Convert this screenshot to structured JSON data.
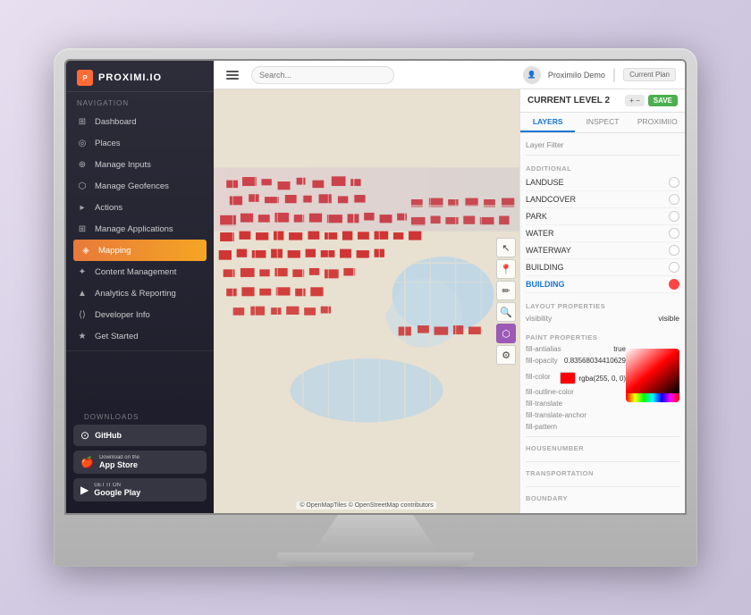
{
  "monitor": {
    "label": "Monitor display"
  },
  "app": {
    "logo": {
      "icon": "P",
      "text": "PROXIMI.IO"
    },
    "topbar": {
      "search_placeholder": "Search...",
      "user_name": "ProximiIo Demo",
      "plan_label": "Current Plan"
    },
    "sidebar": {
      "nav_label": "NAVIGATION",
      "downloads_label": "DOWNLOADS",
      "items": [
        {
          "id": "dashboard",
          "label": "Dashboard",
          "icon": "⊞"
        },
        {
          "id": "places",
          "label": "Places",
          "icon": "◎"
        },
        {
          "id": "manage-inputs",
          "label": "Manage Inputs",
          "icon": "⊕"
        },
        {
          "id": "manage-geofences",
          "label": "Manage Geofences",
          "icon": "⬡"
        },
        {
          "id": "actions",
          "label": "Actions",
          "icon": "▸"
        },
        {
          "id": "manage-applications",
          "label": "Manage Applications",
          "icon": "⊞"
        },
        {
          "id": "mapping",
          "label": "Mapping",
          "icon": "◈",
          "active": true
        },
        {
          "id": "content-management",
          "label": "Content Management",
          "icon": "✦"
        },
        {
          "id": "analytics",
          "label": "Analytics & Reporting",
          "icon": "▲"
        },
        {
          "id": "developer-info",
          "label": "Developer Info",
          "icon": "⟨⟩"
        },
        {
          "id": "get-started",
          "label": "Get Started",
          "icon": "★"
        }
      ],
      "downloads": [
        {
          "id": "github",
          "small": "",
          "large": "GitHub",
          "icon": "⊙"
        },
        {
          "id": "appstore",
          "small": "Download on the",
          "large": "App Store",
          "icon": "🍎"
        },
        {
          "id": "googleplay",
          "small": "GET IT ON",
          "large": "Google Play",
          "icon": "▶"
        }
      ]
    },
    "right_panel": {
      "title": "CURRENT LEVEL 2",
      "level_btn": "+  −",
      "save_btn": "SAVE",
      "tabs": [
        {
          "id": "layers",
          "label": "LAYERS",
          "active": true
        },
        {
          "id": "inspect",
          "label": "INSPECT"
        },
        {
          "id": "proximio",
          "label": "PROXIMIIO"
        }
      ],
      "layer_filter_label": "Layer Filter",
      "section_label": "ADDITIONAL",
      "layers": [
        {
          "name": "LANDUSE",
          "active": false
        },
        {
          "name": "LANDCOVER",
          "active": false
        },
        {
          "name": "PARK",
          "active": false
        },
        {
          "name": "WATER",
          "active": false
        },
        {
          "name": "WATERWAY",
          "active": false
        },
        {
          "name": "BUILDING",
          "active": false
        },
        {
          "name": "BUILDING",
          "active": true
        }
      ],
      "layout_section": "LAYOUT PROPERTIES",
      "layout_rows": [
        {
          "key": "visibility",
          "val": "visible"
        }
      ],
      "paint_section": "PAINT PROPERTIES",
      "paint_rows": [
        {
          "key": "fill-antialias",
          "val": "true"
        },
        {
          "key": "fill-opacity",
          "val": "0.83568034410629"
        },
        {
          "key": "fill-color",
          "val": "rgba(255, 0, 0)"
        },
        {
          "key": "fill-outline-color",
          "val": ""
        },
        {
          "key": "fill-translate",
          "val": ""
        },
        {
          "key": "fill-translate-anchor",
          "val": ""
        },
        {
          "key": "fill-pattern",
          "val": ""
        }
      ],
      "bottom_sections": [
        {
          "name": "HOUSENUMBER"
        },
        {
          "name": "TRANSPORTATION"
        },
        {
          "name": "BOUNDARY"
        }
      ]
    },
    "map": {
      "attribution": "© OpenMapTiles © OpenStreetMap contributors"
    }
  }
}
